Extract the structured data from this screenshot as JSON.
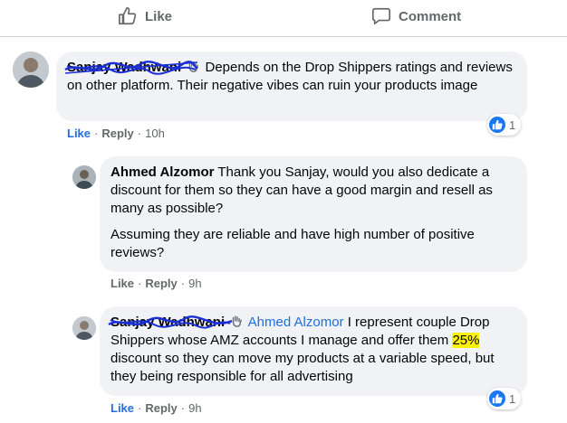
{
  "actions": {
    "like_label": "Like",
    "comment_label": "Comment"
  },
  "comments": [
    {
      "author": "Sanjay Wadhwani",
      "text": "Depends on the Drop Shippers ratings and reviews on other platform. Their negative vibes can ruin your products image",
      "reaction_count": "1",
      "like_label": "Like",
      "reply_label": "Reply",
      "time": "10h"
    },
    {
      "author": "Ahmed Alzomor",
      "text1": "Thank you Sanjay, would you also dedicate a discount for them so they can have a good margin and resell as many as possible?",
      "text2": "Assuming they are reliable and have high number of positive reviews?",
      "like_label": "Like",
      "reply_label": "Reply",
      "time": "9h"
    },
    {
      "author": "Sanjay Wadhwani",
      "mention": "Ahmed Alzomor",
      "text_a": "I represent couple Drop Shippers whose AMZ accounts I manage and offer them",
      "highlight": "25%",
      "text_b": "discount so they can move my products at a variable speed, but they being responsible for all advertising",
      "reaction_count": "1",
      "like_label": "Like",
      "reply_label": "Reply",
      "time": "9h"
    }
  ],
  "colors": {
    "link_blue": "#216fdb",
    "bubble": "#f0f2f5",
    "meta_gray": "#65676b",
    "highlight": "#fff200",
    "scribble": "#1a2fd6"
  }
}
